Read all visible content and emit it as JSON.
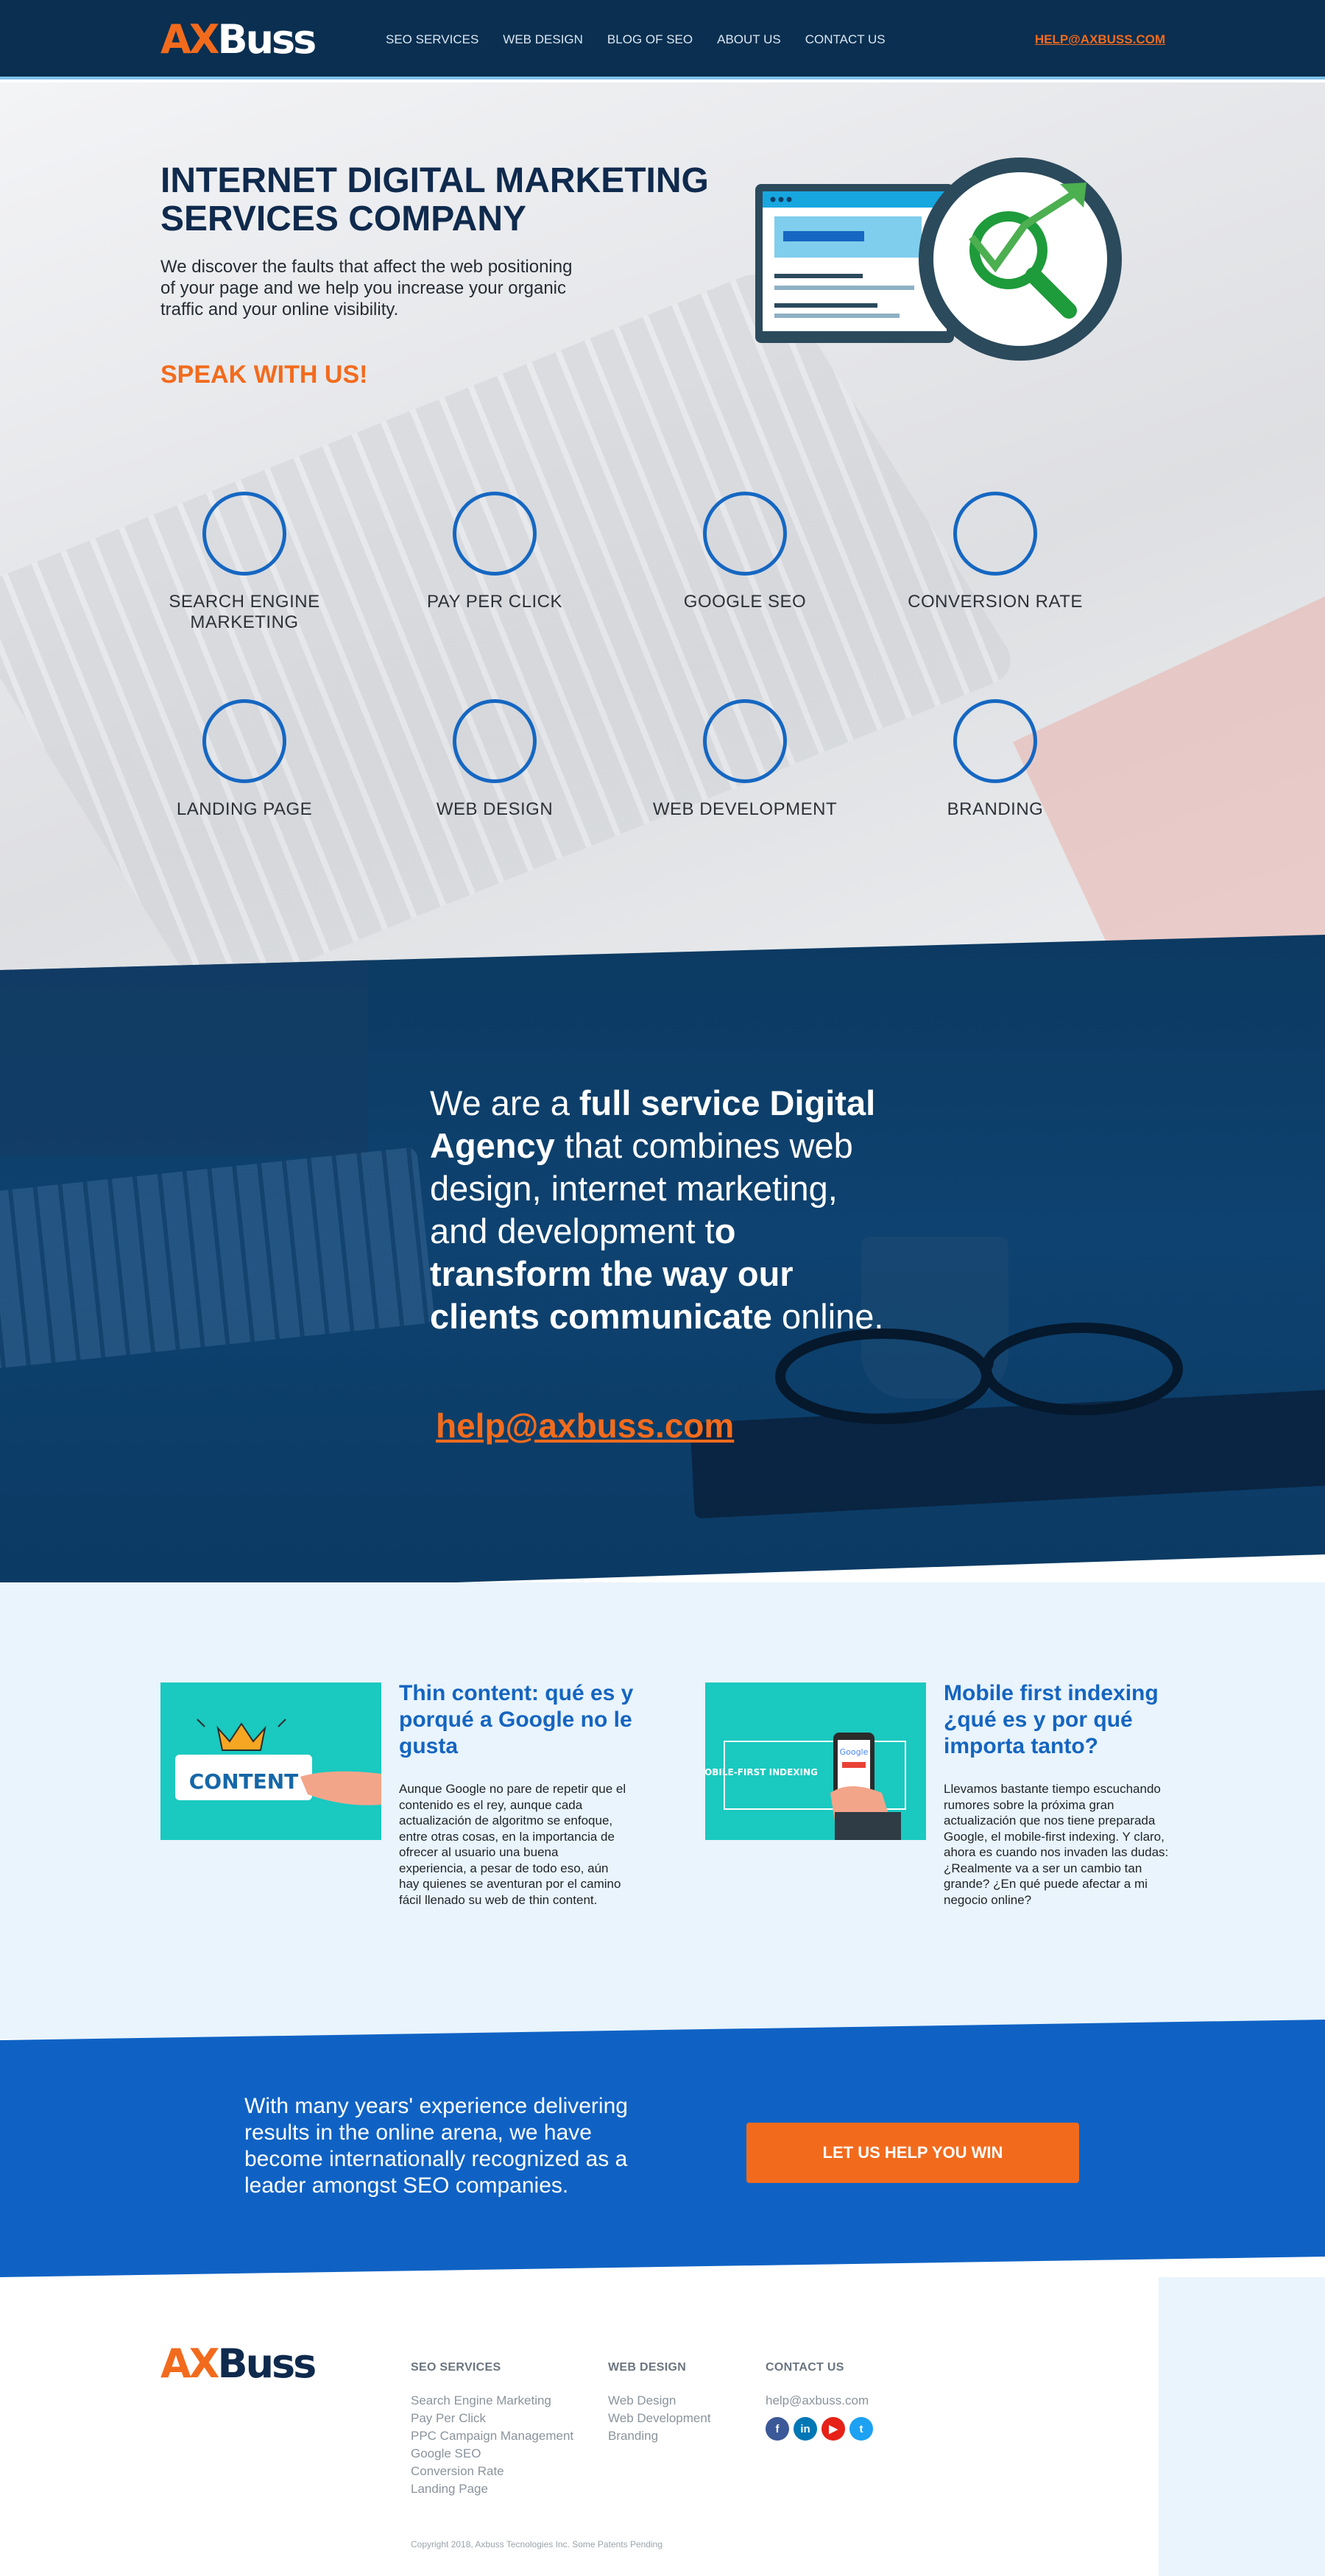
{
  "header": {
    "logo_ax": "AX",
    "logo_buss": "Buss",
    "nav": [
      "SEO SERVICES",
      "WEB DESIGN",
      "BLOG OF SEO",
      "ABOUT US",
      "CONTACT US"
    ],
    "email": "HELP@AXBUSS.COM"
  },
  "hero": {
    "title_line1": "INTERNET DIGITAL MARKETING",
    "title_line2": "SERVICES COMPANY",
    "description": "We discover the faults that affect the web positioning of your page and we help you increase your organic traffic and your online visibility.",
    "cta": "SPEAK WITH US!",
    "services": [
      "SEARCH ENGINE MARKETING",
      "PAY PER CLICK",
      "GOOGLE SEO",
      "CONVERSION RATE",
      "LANDING PAGE",
      "WEB DESIGN",
      "WEB DEVELOPMENT",
      "BRANDING"
    ]
  },
  "agency": {
    "t1": "We are a ",
    "t2": "full service Digital Agency",
    "t3": " that combines web design, internet marketing, and development t",
    "t4": "o transform the way our clients communicate",
    "t5": " online.",
    "email": "help@axbuss.com"
  },
  "blog": {
    "posts": [
      {
        "title": "Thin content: qué es y porqué a Google no le gusta",
        "thumb_label": "CONTENT",
        "body": "Aunque Google no pare de repetir que el contenido es el rey, aunque cada actualización de algoritmo se enfoque, entre otras cosas, en la importancia de ofrecer al usuario una buena experiencia, a pesar de todo eso, aún hay quienes se aventuran por el camino fácil llenado su web de thin content."
      },
      {
        "title": "Mobile first indexing ¿qué es y por qué importa tanto?",
        "thumb_label": "MOBILE-FIRST INDEXING",
        "thumb_brand": "Google",
        "body": "Llevamos bastante tiempo escuchando rumores sobre la próxima gran actualización que nos tiene preparada Google, el mobile-first indexing. Y claro, ahora es cuando nos invaden las dudas: ¿Realmente va a ser un cambio tan grande? ¿En qué puede afectar a mi negocio online?"
      }
    ]
  },
  "cta": {
    "text": "With many years' experience delivering results in the online arena, we have become internationally recognized as a leader amongst SEO companies.",
    "button": "LET US HELP YOU WIN"
  },
  "footer": {
    "logo_ax": "AX",
    "logo_buss": "Buss",
    "columns": [
      {
        "heading": "SEO SERVICES",
        "links": [
          "Search Engine Marketing",
          "Pay Per Click",
          "PPC Campaign Management",
          "Google SEO",
          "Conversion Rate",
          "Landing Page"
        ]
      },
      {
        "heading": "WEB DESIGN",
        "links": [
          "Web Design",
          "Web Development",
          "Branding"
        ]
      },
      {
        "heading": "CONTACT US",
        "links": [
          "help@axbuss.com"
        ]
      }
    ],
    "social_icons": [
      "facebook-icon",
      "linkedin-icon",
      "youtube-icon",
      "twitter-icon"
    ],
    "copyright": "Copyright 2018, Axbuss Tecnologies Inc. Some Patents Pending"
  },
  "colors": {
    "navy": "#0a2f50",
    "orange": "#f26b1d",
    "blue": "#0f62c4",
    "teal": "#1ac9c0",
    "light_blue_bg": "#e9f4fd"
  }
}
